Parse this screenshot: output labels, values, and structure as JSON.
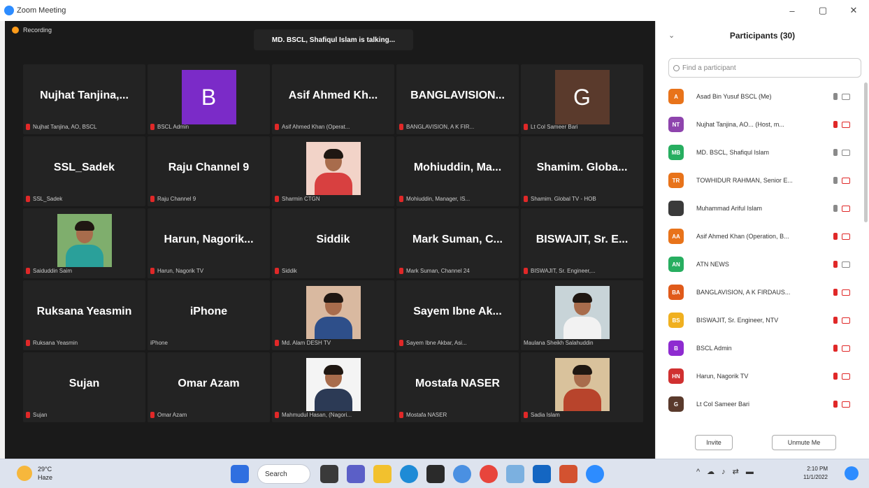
{
  "window": {
    "title": "Zoom Meeting",
    "controls": {
      "minimize": "–",
      "restore": "▢",
      "close": "✕"
    }
  },
  "meeting": {
    "recording_label": "Recording",
    "talking_banner": "MD. BSCL, Shafiqul Islam is talking...",
    "tiles": [
      {
        "kind": "name",
        "display": "Nujhat Tanjina,...",
        "label": "Nujhat Tanjina, AO, BSCL"
      },
      {
        "kind": "avatar",
        "letter": "B",
        "color": "#7b2bc8",
        "label": "BSCL Admin"
      },
      {
        "kind": "name",
        "display": "Asif Ahmed Kh...",
        "label": "Asif Ahmed Khan (Operat..."
      },
      {
        "kind": "name",
        "display": "BANGLAVISION...",
        "label": "BANGLAVISION, A K FIR..."
      },
      {
        "kind": "avatar",
        "letter": "G",
        "color": "#5a3a2c",
        "label": "Lt Col Sameer Bari"
      },
      {
        "kind": "name",
        "display": "SSL_Sadek",
        "label": "SSL_Sadek"
      },
      {
        "kind": "name",
        "display": "Raju Channel 9",
        "label": "Raju Channel 9"
      },
      {
        "kind": "photo",
        "shirt": "#d84040",
        "bg": "#f2d3c8",
        "label": "Sharmin CTGN"
      },
      {
        "kind": "name",
        "display": "Mohiuddin, Ma...",
        "label": "Mohiuddin, Manager, IS..."
      },
      {
        "kind": "name",
        "display": "Shamim. Globa...",
        "label": "Shamim. Global TV - HOB"
      },
      {
        "kind": "photo",
        "shirt": "#2aa09a",
        "bg": "#7fae6d",
        "label": "Saiduddin Saim"
      },
      {
        "kind": "name",
        "display": "Harun, Nagorik...",
        "label": "Harun, Nagorik TV"
      },
      {
        "kind": "name",
        "display": "Siddik",
        "label": "Siddik"
      },
      {
        "kind": "name",
        "display": "Mark Suman, C...",
        "label": "Mark Suman, Channel 24"
      },
      {
        "kind": "name",
        "display": "BISWAJIT, Sr. E...",
        "label": "BISWAJIT, Sr. Engineer,..."
      },
      {
        "kind": "name",
        "display": "Ruksana Yeasmin",
        "label": "Ruksana Yeasmin"
      },
      {
        "kind": "name",
        "display": "iPhone",
        "label": "iPhone",
        "nomic": true
      },
      {
        "kind": "photo",
        "shirt": "#2e4f8a",
        "bg": "#d9b9a0",
        "label": "Md. Alam DESH TV"
      },
      {
        "kind": "name",
        "display": "Sayem Ibne Ak...",
        "label": "Sayem Ibne Akbar, Asi..."
      },
      {
        "kind": "photo",
        "shirt": "#f2f2f2",
        "bg": "#c8d4d8",
        "label": "Maulana Sheikh Salahuddin",
        "nomic": true
      },
      {
        "kind": "name",
        "display": "Sujan",
        "label": "Sujan"
      },
      {
        "kind": "name",
        "display": "Omar Azam",
        "label": "Omar Azam"
      },
      {
        "kind": "photo",
        "shirt": "#2c3a55",
        "bg": "#f4f4f4",
        "label": "Mahmudul Hasan, (Nagori..."
      },
      {
        "kind": "name",
        "display": "Mostafa NASER",
        "label": "Mostafa NASER"
      },
      {
        "kind": "photo",
        "shirt": "#b8442c",
        "bg": "#d9c29c",
        "label": "Sadia Islam"
      }
    ]
  },
  "participants": {
    "title": "Participants (30)",
    "search_placeholder": "Find a participant",
    "list": [
      {
        "initials": "A",
        "color": "#e8731a",
        "name": "Asad Bin Yusuf BSCL (Me)",
        "mic_on": true,
        "video_on": false
      },
      {
        "initials": "NT",
        "color": "#8e44ad",
        "name": "Nujhat Tanjina, AO... (Host, m...",
        "mic_on": false,
        "video_on": true
      },
      {
        "initials": "MB",
        "color": "#27ae60",
        "name": "MD. BSCL, Shafiqul Islam",
        "mic_on": true,
        "video_on": false
      },
      {
        "initials": "TR",
        "color": "#e8731a",
        "name": "TOWHIDUR RAHMAN, Senior E...",
        "mic_on": true,
        "video_on": true
      },
      {
        "initials": "",
        "color": "#3a3a3a",
        "name": "Muhammad Ariful Islam",
        "mic_on": true,
        "video_on": true
      },
      {
        "initials": "AA",
        "color": "#e8731a",
        "name": "Asif Ahmed Khan (Operation, B...",
        "mic_on": false,
        "video_on": true
      },
      {
        "initials": "AN",
        "color": "#27ae60",
        "name": "ATN NEWS",
        "mic_on": false,
        "video_on": false
      },
      {
        "initials": "BA",
        "color": "#e05a1a",
        "name": "BANGLAVISION, A K FIRDAUS...",
        "mic_on": false,
        "video_on": true
      },
      {
        "initials": "BS",
        "color": "#f0b020",
        "name": "BISWAJIT, Sr. Engineer, NTV",
        "mic_on": false,
        "video_on": true
      },
      {
        "initials": "B",
        "color": "#8e2bd0",
        "name": "BSCL Admin",
        "mic_on": false,
        "video_on": true
      },
      {
        "initials": "HN",
        "color": "#d03030",
        "name": "Harun, Nagorik TV",
        "mic_on": false,
        "video_on": true
      },
      {
        "initials": "G",
        "color": "#5a3a2c",
        "name": "Lt Col Sameer Bari",
        "mic_on": false,
        "video_on": true
      }
    ],
    "invite_label": "Invite",
    "unmute_label": "Unmute Me"
  },
  "taskbar": {
    "weather_temp": "29°C",
    "weather_desc": "Haze",
    "search_label": "Search",
    "app_icons": [
      {
        "name": "start-icon",
        "color": "#2f6fe0"
      },
      {
        "name": "taskview-icon",
        "color": "#3a3a3a"
      },
      {
        "name": "chat-icon",
        "color": "#5b5fc7"
      },
      {
        "name": "file-explorer-icon",
        "color": "#f2c12e"
      },
      {
        "name": "edge-icon",
        "color": "#1e8bd6"
      },
      {
        "name": "store-icon",
        "color": "#2a2a2a"
      },
      {
        "name": "chrome-icon",
        "color": "#4a90e2"
      },
      {
        "name": "chrome-profile-icon",
        "color": "#e8453c"
      },
      {
        "name": "photos-icon",
        "color": "#7bb0e0"
      },
      {
        "name": "outlook-icon",
        "color": "#1466c2"
      },
      {
        "name": "powerpoint-icon",
        "color": "#d35230"
      },
      {
        "name": "zoom-icon",
        "color": "#2d8cff"
      }
    ],
    "tray": [
      "^",
      "☁",
      "♪",
      "⇄",
      "▬"
    ],
    "time": "2:10 PM",
    "date": "11/1/2022"
  }
}
